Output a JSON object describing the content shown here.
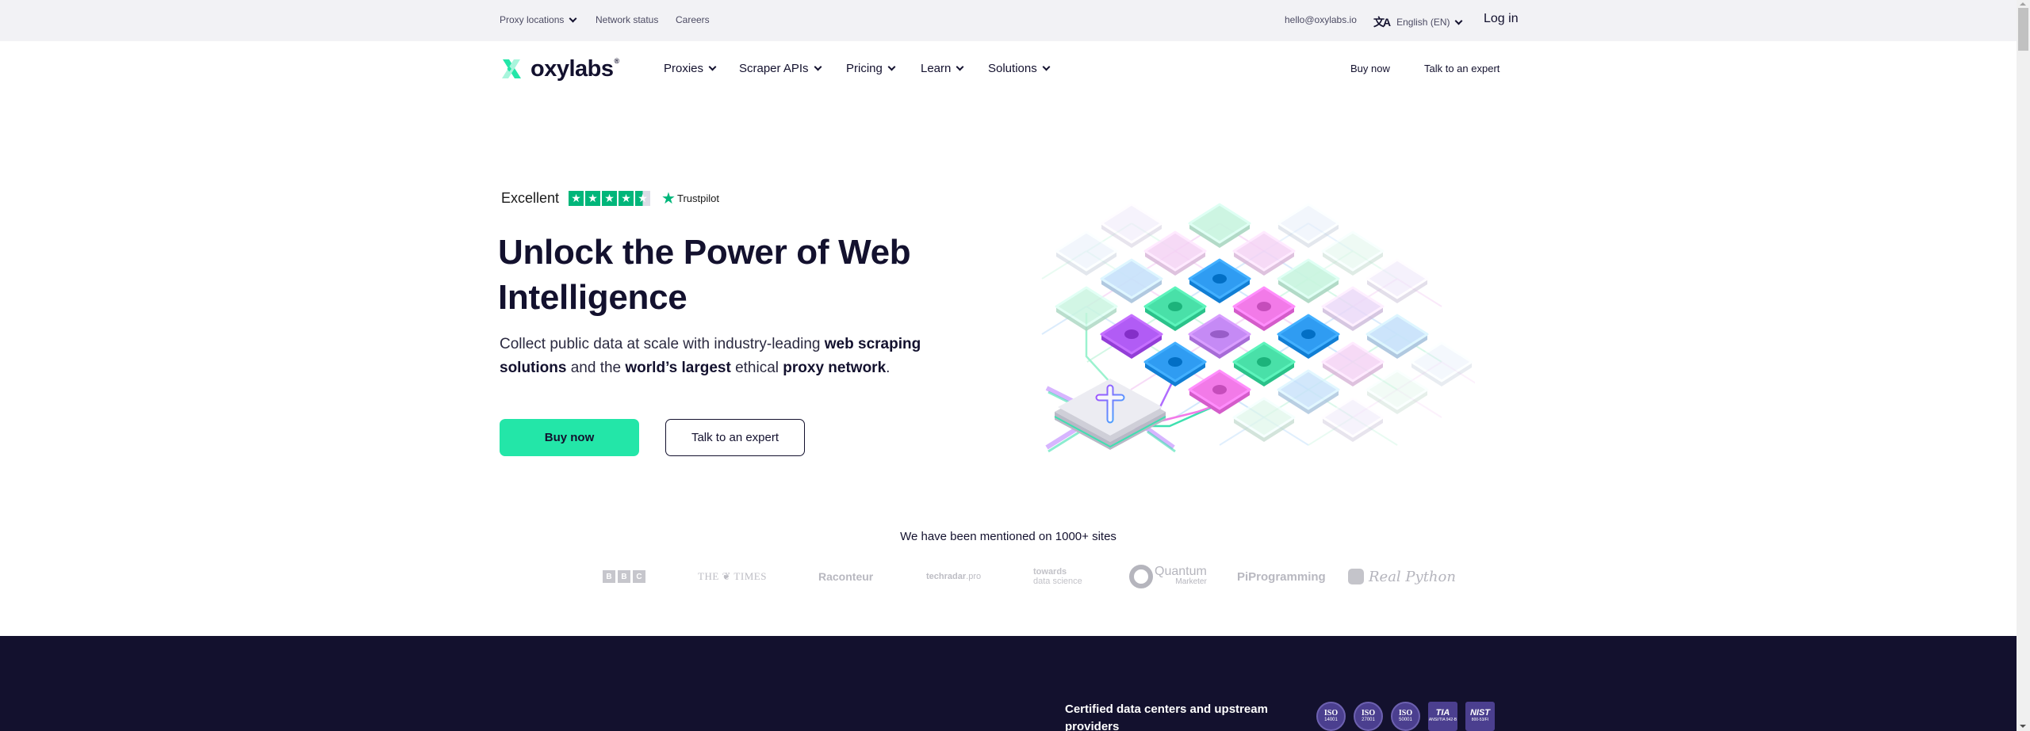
{
  "topbar": {
    "proxy_locations": "Proxy locations",
    "network_status": "Network status",
    "careers": "Careers",
    "email": "hello@oxylabs.io",
    "language": "English (EN)",
    "login": "Log in"
  },
  "nav": {
    "logo_text": "oxylabs",
    "logo_reg": "®",
    "items": [
      {
        "label": "Proxies"
      },
      {
        "label": "Scraper APIs"
      },
      {
        "label": "Pricing"
      },
      {
        "label": "Learn"
      },
      {
        "label": "Solutions"
      }
    ],
    "buy_now": "Buy now",
    "talk_expert": "Talk to an expert"
  },
  "hero": {
    "trust_label": "Excellent",
    "trust_rating_stars": 4.5,
    "trust_brand": "Trustpilot",
    "title": "Unlock the Power of Web Intelligence",
    "sub_parts": [
      {
        "text": "Collect public data at scale with industry-leading ",
        "bold": false
      },
      {
        "text": "web scraping solutions",
        "bold": true
      },
      {
        "text": " and the ",
        "bold": false
      },
      {
        "text": "world’s largest",
        "bold": true
      },
      {
        "text": " ethical ",
        "bold": false
      },
      {
        "text": "proxy network",
        "bold": true
      },
      {
        "text": ".",
        "bold": false
      }
    ],
    "buy_now": "Buy now",
    "talk_expert": "Talk to an expert"
  },
  "mentions": {
    "title": "We have been mentioned on 1000+ sites",
    "logos": {
      "bbc": [
        "B",
        "B",
        "C"
      ],
      "times": "THE ❦ TIMES",
      "raconteur": "Raconteur",
      "techradar_bold": "techradar",
      "techradar_rest": ".pro",
      "tds_line1": "towards",
      "tds_line2": "data science",
      "quantum_line1": "Quantum",
      "quantum_line2": "Marketer",
      "piprogramming": "PiProgramming",
      "realpython": "Real Python"
    }
  },
  "certified": {
    "text": "Certified data centers and upstream providers",
    "badges": [
      {
        "type": "iso",
        "name": "ISO",
        "code": "14001"
      },
      {
        "type": "iso",
        "name": "ISO",
        "code": "27001"
      },
      {
        "type": "iso",
        "name": "ISO",
        "code": "50001"
      },
      {
        "type": "square",
        "name": "TIA",
        "code": "ANSI/TIA 942-B"
      },
      {
        "type": "square",
        "name": "NIST",
        "code": "800-53/FI"
      }
    ]
  },
  "colors": {
    "brand_green": "#23e6a8",
    "navy": "#13112e",
    "trustpilot_green": "#00b67a",
    "topbar_bg": "#f2f2f5"
  }
}
